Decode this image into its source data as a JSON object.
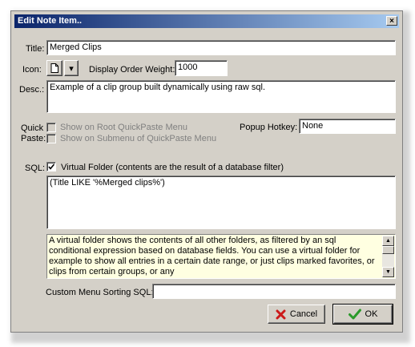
{
  "dialog": {
    "title": "Edit Note Item..",
    "close_glyph": "×"
  },
  "title_row": {
    "label": "Title:",
    "value": "Merged Clips"
  },
  "icon_row": {
    "label": "Icon:",
    "dropdown_glyph": "▾",
    "order_label": "Display Order Weight:",
    "order_value": "1000"
  },
  "desc": {
    "label": "Desc.:",
    "value": "Example of a clip group built dynamically using raw sql."
  },
  "quickpaste": {
    "label_line1": "Quick",
    "label_line2": "Paste:",
    "root_menu_label": "Show on Root QuickPaste Menu",
    "submenu_label": "Show on Submenu of QuickPaste Menu"
  },
  "popup_hotkey": {
    "label": "Popup Hotkey:",
    "value": "None"
  },
  "sql": {
    "label": "SQL:",
    "virtual_folder_label": "Virtual Folder (contents are the result of a database filter)",
    "virtual_folder_checked": true,
    "query": "(Title LIKE '%Merged clips%')"
  },
  "help_text": "A virtual folder shows the contents of all other folders, as filtered by an sql conditional expression based on database fields.  You can use a virtual folder for example to show all entries in a certain date range, or just clips marked favorites, or clips from certain groups, or any",
  "custom_sort": {
    "label": "Custom Menu Sorting SQL:",
    "value": ""
  },
  "buttons": {
    "cancel": "Cancel",
    "ok": "OK"
  },
  "colors": {
    "titlebar_start": "#0a246a",
    "titlebar_end": "#a6caf0",
    "help_bg": "#ffffe1",
    "cancel_icon": "#cc1a1a",
    "ok_icon": "#2a9a2a"
  }
}
